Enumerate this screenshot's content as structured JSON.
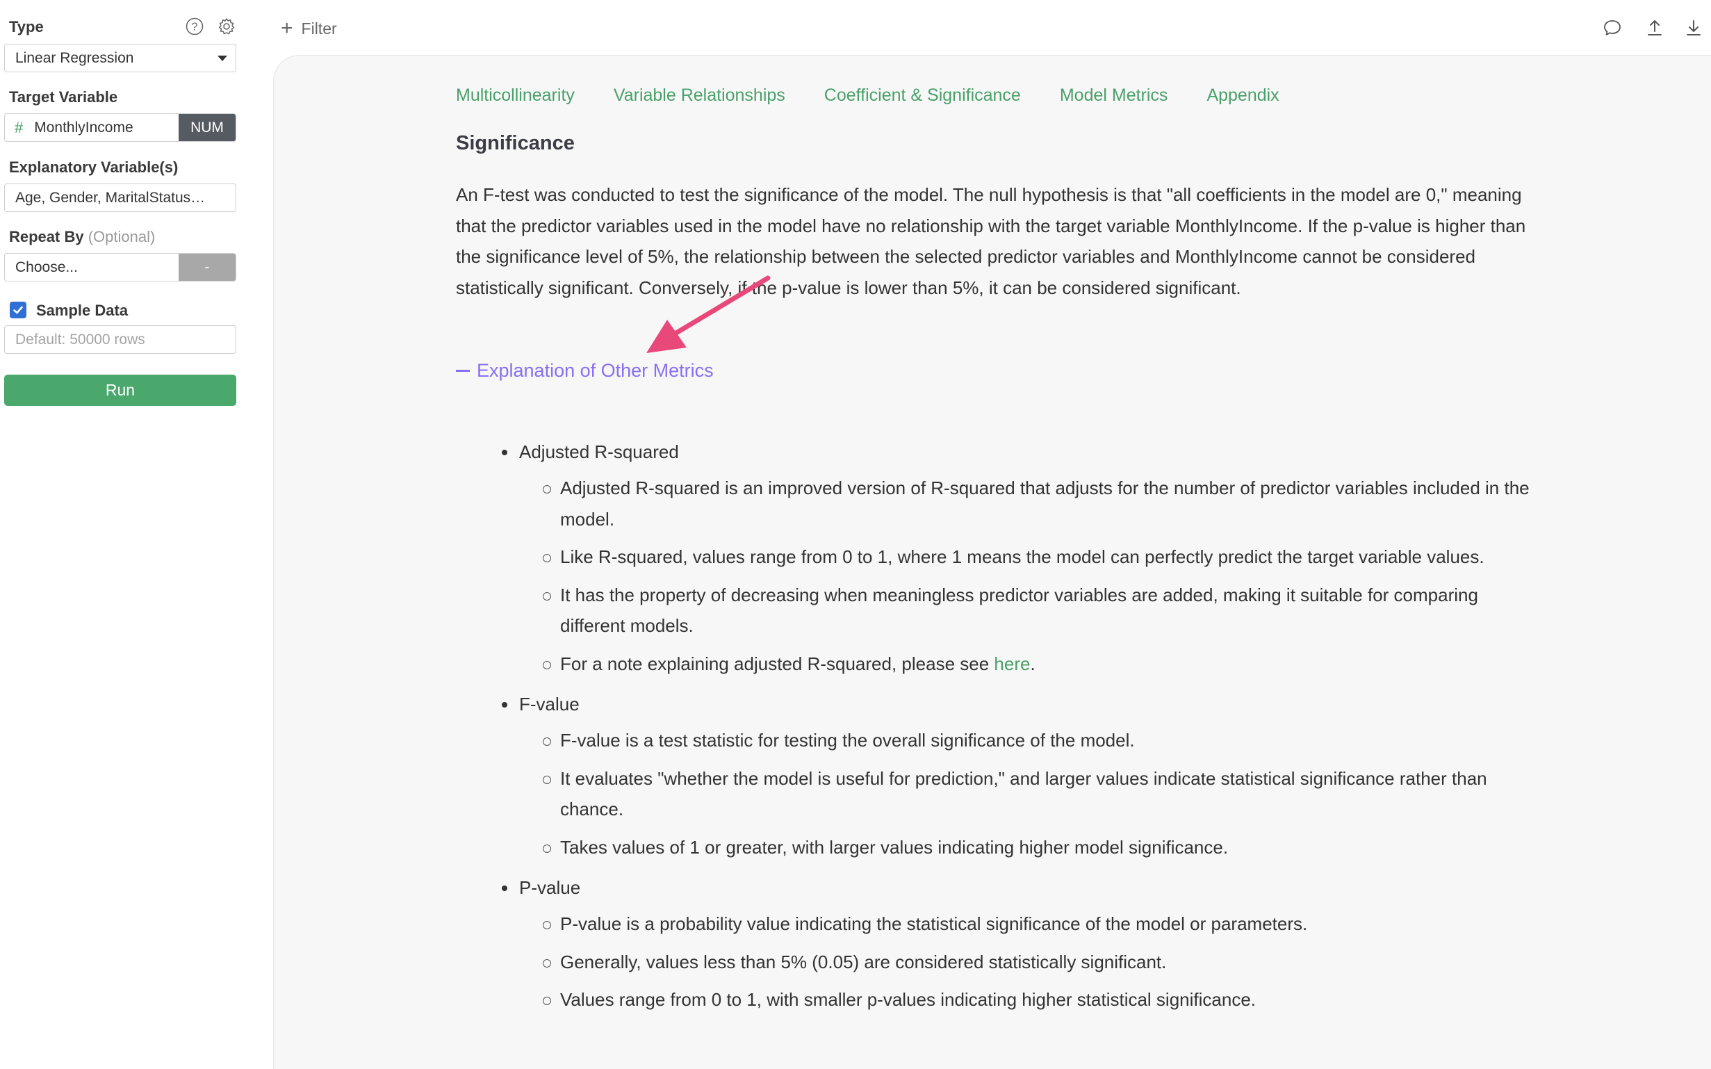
{
  "sidebar": {
    "type_label": "Type",
    "type_value": "Linear Regression",
    "target_label": "Target Variable",
    "target_value": "MonthlyIncome",
    "target_badge": "NUM",
    "target_prefix": "#",
    "explanatory_label": "Explanatory Variable(s)",
    "explanatory_value": "Age, Gender, MaritalStatus…",
    "repeat_label": "Repeat By",
    "repeat_optional": "(Optional)",
    "repeat_value": "Choose...",
    "repeat_badge": "-",
    "sample_label": "Sample Data",
    "sample_checked": true,
    "sample_placeholder": "Default: 50000 rows",
    "run_label": "Run"
  },
  "topbar": {
    "filter_label": "Filter",
    "icons": [
      "comment-icon",
      "upload-icon",
      "download-icon"
    ]
  },
  "main": {
    "tabs": [
      {
        "label": "Multicollinearity"
      },
      {
        "label": "Variable Relationships"
      },
      {
        "label": "Coefficient & Significance"
      },
      {
        "label": "Model Metrics"
      },
      {
        "label": "Appendix"
      }
    ],
    "section_title": "Significance",
    "paragraph": "An F-test was conducted to test the significance of the model. The null hypothesis is that \"all coefficients in the model are 0,\" meaning that the predictor variables used in the model have no relationship with the target variable MonthlyIncome. If the p-value is higher than the significance level of 5%, the relationship between the selected predictor variables and MonthlyIncome cannot be considered statistically significant. Conversely, if the p-value is lower than 5%, it can be considered significant.",
    "toggle_label": "Explanation of Other Metrics",
    "metrics": [
      {
        "title": "Adjusted R-squared",
        "items": [
          "Adjusted R-squared is an improved version of R-squared that adjusts for the number of predictor variables included in the model.",
          "Like R-squared, values range from 0 to 1, where 1 means the model can perfectly predict the target variable values.",
          "It has the property of decreasing when meaningless predictor variables are added, making it suitable for comparing different models."
        ],
        "note_prefix": "For a note explaining adjusted R-squared, please see ",
        "note_link": "here",
        "note_suffix": "."
      },
      {
        "title": "F-value",
        "items": [
          "F-value is a test statistic for testing the overall significance of the model.",
          "It evaluates \"whether the model is useful for prediction,\" and larger values indicate statistical significance rather than chance.",
          "Takes values of 1 or greater, with larger values indicating higher model significance."
        ]
      },
      {
        "title": "P-value",
        "items": [
          "P-value is a probability value indicating the statistical significance of the model or parameters.",
          "Generally, values less than 5% (0.05) are considered statistically significant.",
          "Values range from 0 to 1, with smaller p-values indicating higher statistical significance."
        ]
      }
    ]
  },
  "colors": {
    "accent_green": "#4aa06a",
    "toggle_purple": "#8a6ff0",
    "arrow_pink": "#e8487a"
  }
}
